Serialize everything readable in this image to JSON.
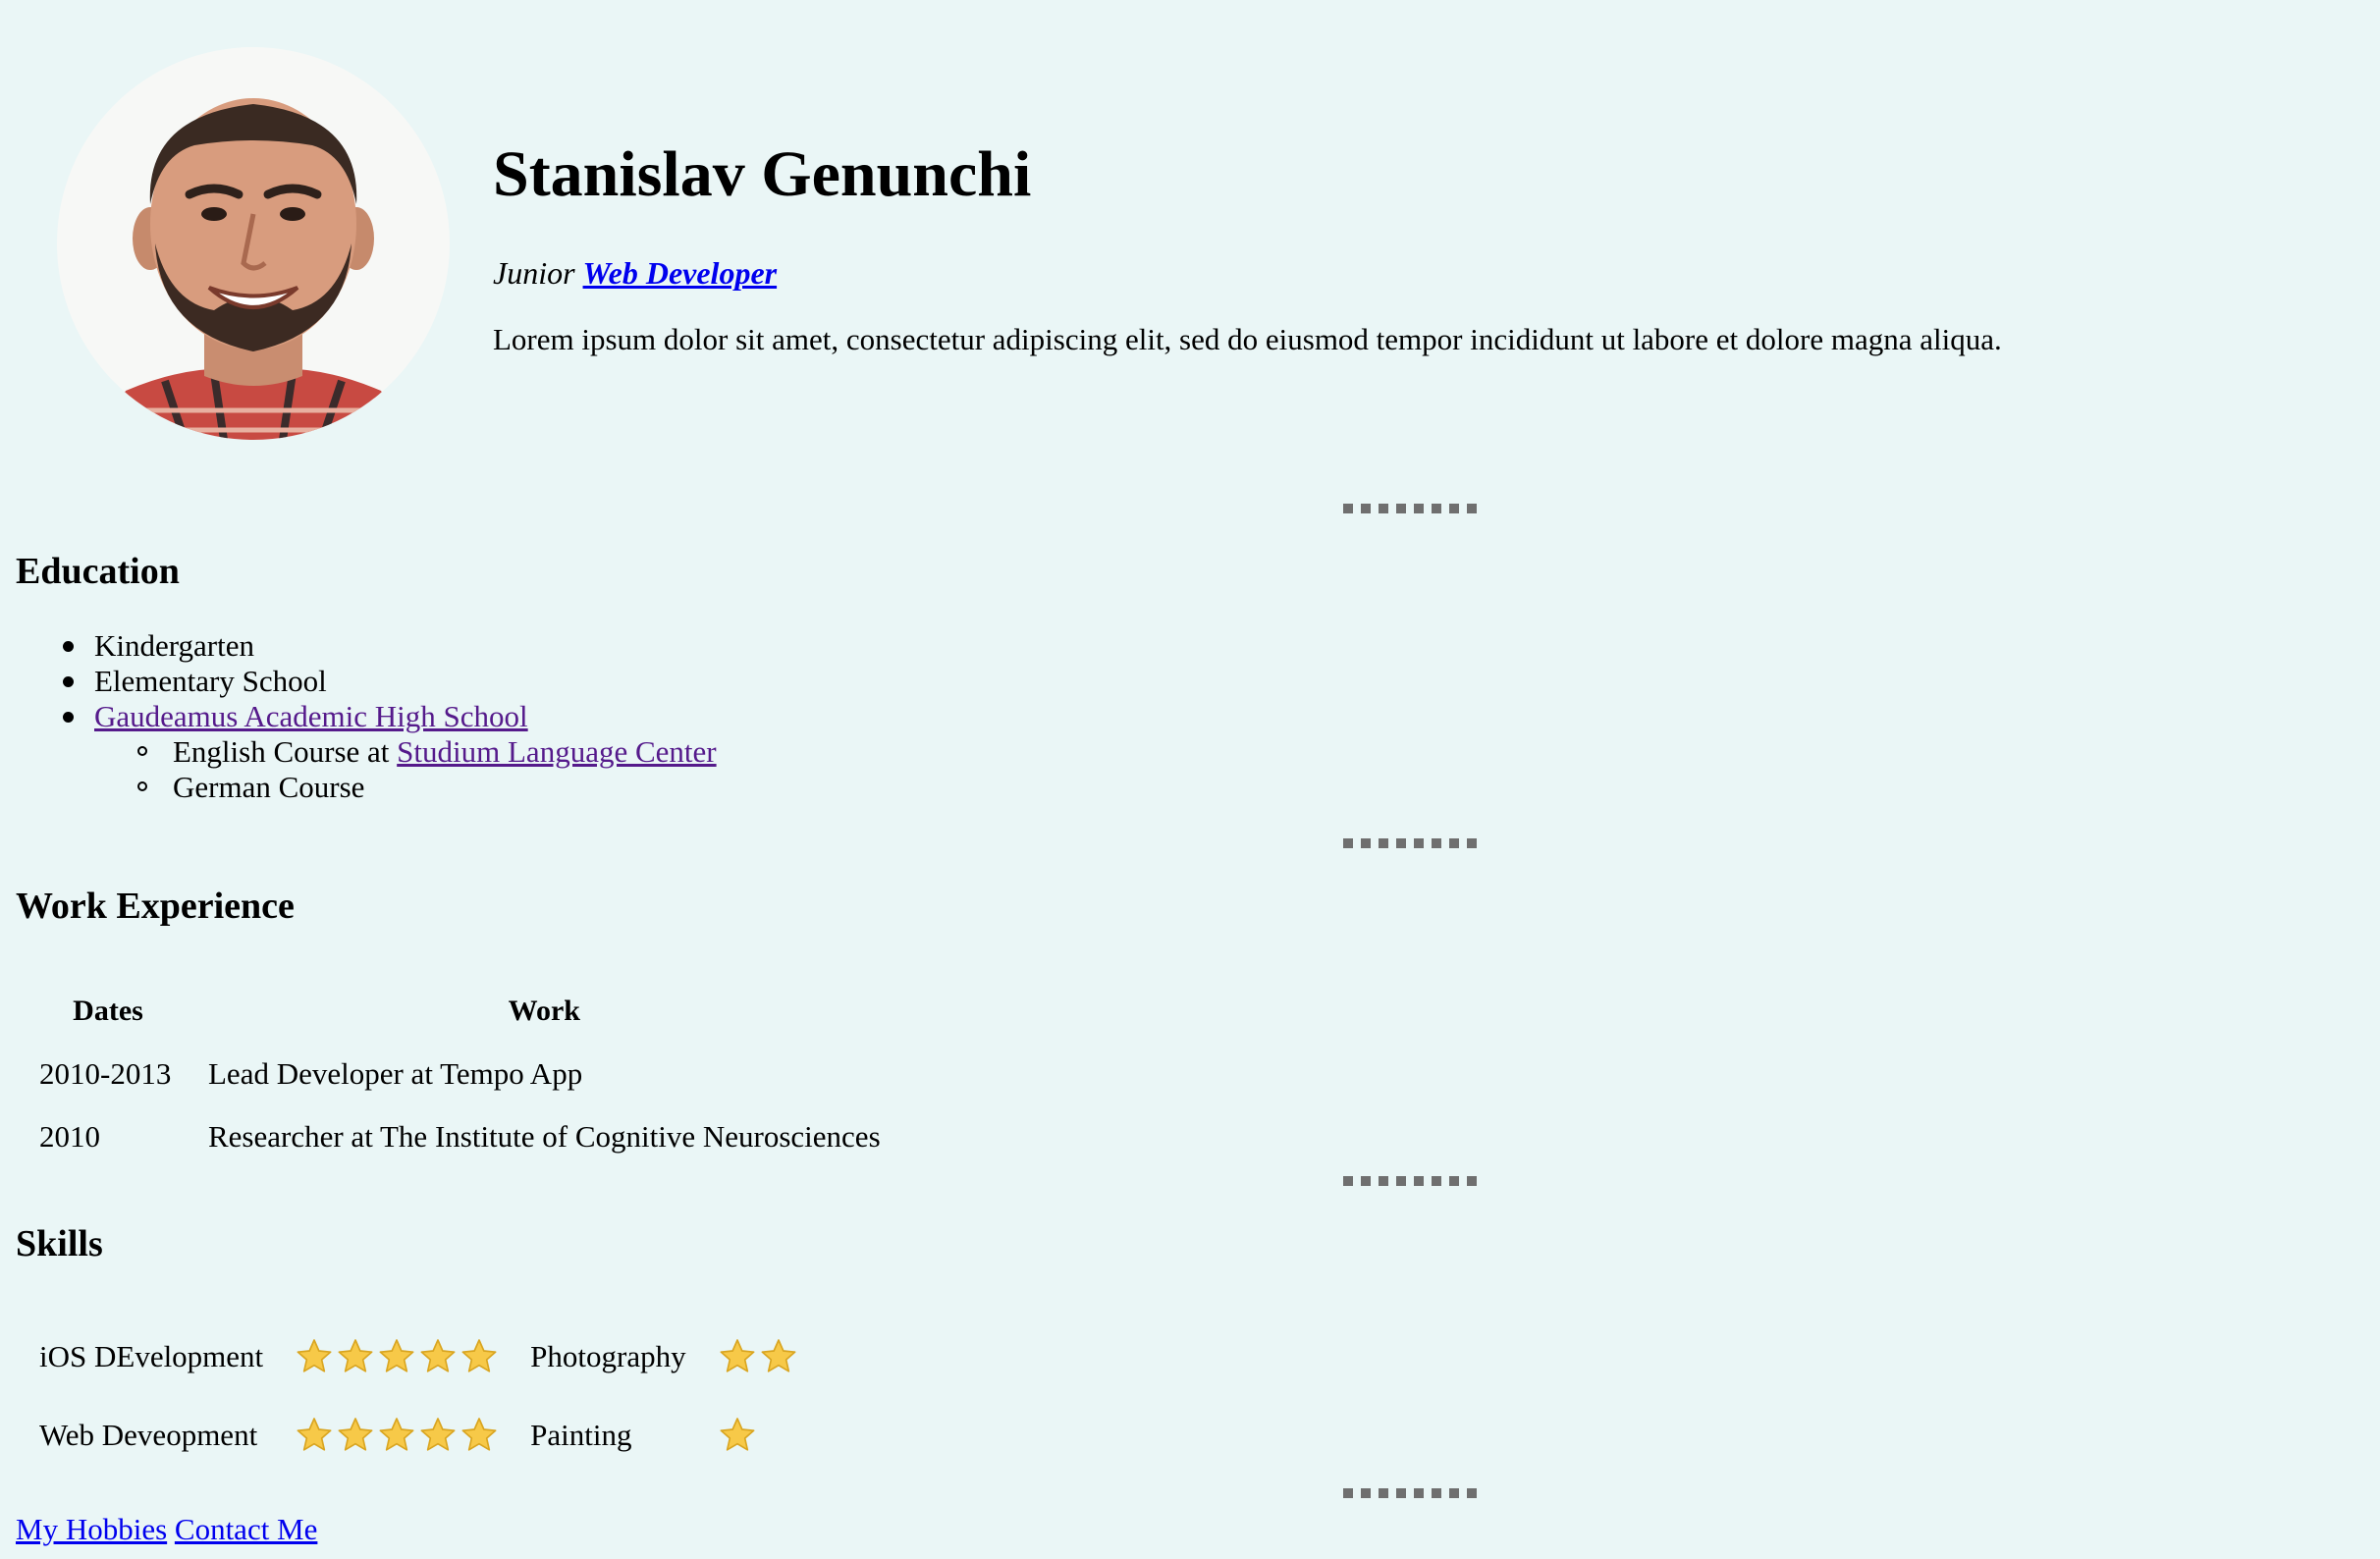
{
  "header": {
    "name": "Stanislav Genunchi",
    "role_prefix": "Junior",
    "role_link": "Web Developer",
    "bio": "Lorem ipsum dolor sit amet, consectetur adipiscing elit, sed do eiusmod tempor incididunt ut labore et dolore magna aliqua.",
    "photo_icon": "profile-photo"
  },
  "education": {
    "title": "Education",
    "items": [
      "Kindergarten",
      "Elementary School",
      "Gaudeamus Academic High School"
    ],
    "sub_items": [
      {
        "text": "English Course at",
        "link": "Studium Language Center"
      },
      {
        "text": "German Course"
      }
    ]
  },
  "work": {
    "title": "Work Experience",
    "headers": [
      "Dates",
      "Work"
    ],
    "rows": [
      {
        "dates": "2010-2013",
        "work": "Lead Developer at Tempo App"
      },
      {
        "dates": "2010",
        "work": "Researcher at The Institute of Cognitive Neurosciences"
      }
    ]
  },
  "skills": {
    "title": "Skills",
    "rows": [
      {
        "skill_a": "iOS DEvelopment",
        "stars_a": 5,
        "skill_b": "Photography",
        "stars_b": 2
      },
      {
        "skill_a": "Web Deveopment",
        "stars_a": 5,
        "skill_b": "Painting",
        "stars_b": 1
      }
    ],
    "star_icon": "star-icon"
  },
  "footer": {
    "links": [
      "My Hobbies",
      "Contact Me"
    ]
  },
  "colors": {
    "background": "#eaf6f6",
    "link": "#0000ee",
    "visited_link": "#551a8b",
    "separator": "#6f6f6f",
    "star": "#f7c948"
  }
}
